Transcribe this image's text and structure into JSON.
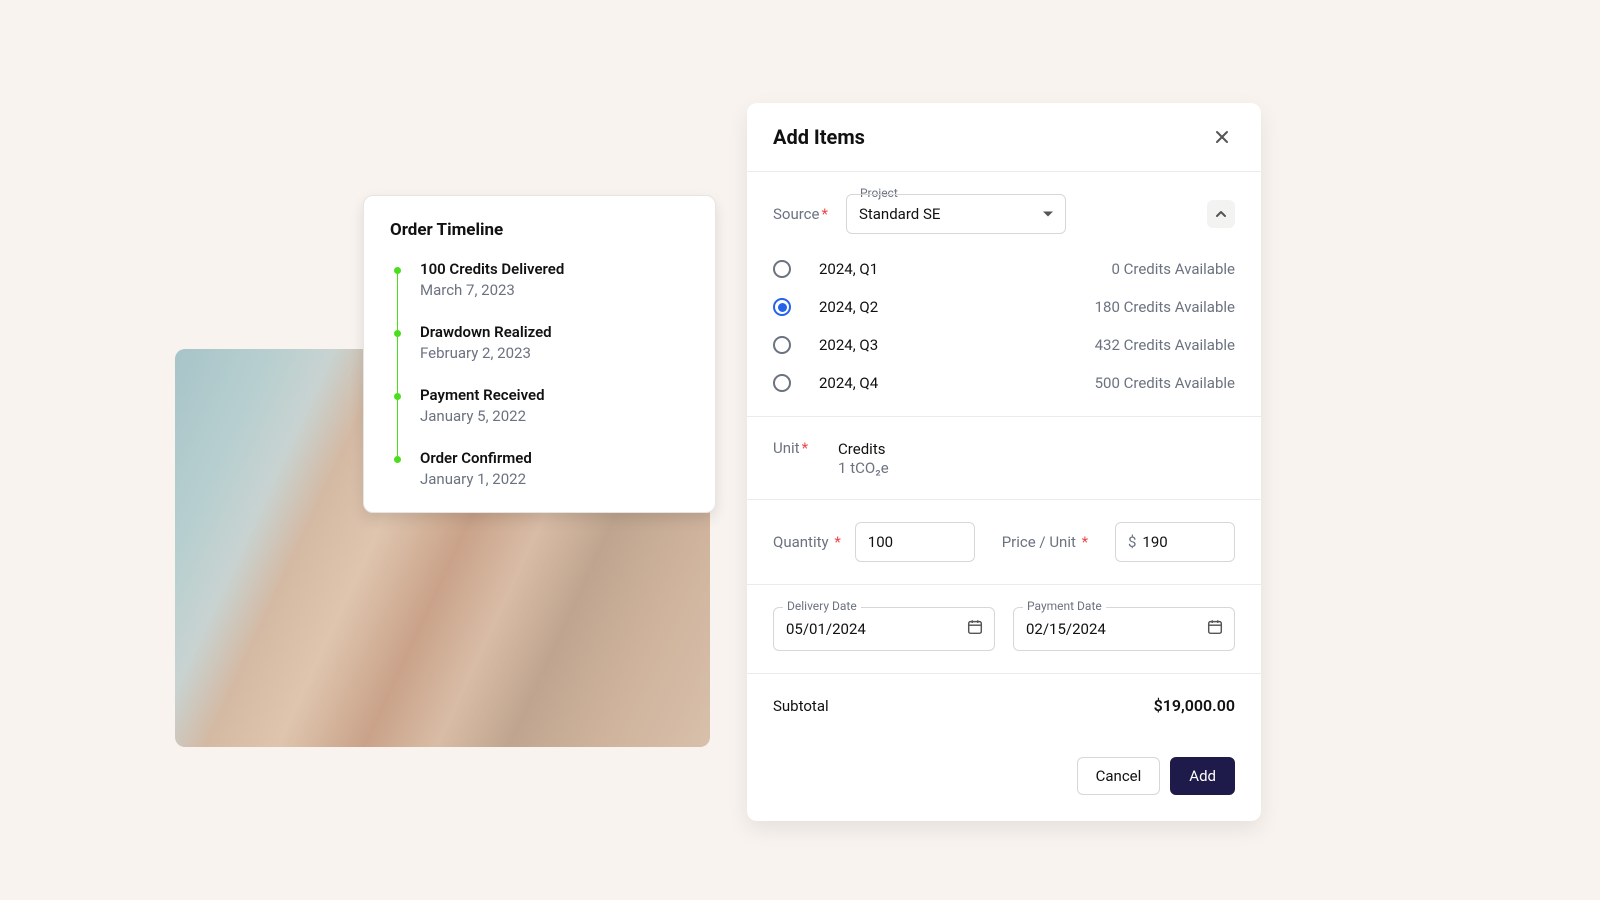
{
  "timeline": {
    "title": "Order Timeline",
    "events": [
      {
        "title": "100 Credits Delivered",
        "date": "March 7, 2023"
      },
      {
        "title": "Drawdown Realized",
        "date": "February 2, 2023"
      },
      {
        "title": "Payment Received",
        "date": "January 5, 2022"
      },
      {
        "title": "Order Confirmed",
        "date": "January 1, 2022"
      }
    ]
  },
  "modal": {
    "title": "Add Items",
    "source": {
      "label": "Source",
      "project_float_label": "Project",
      "project_value": "Standard SE"
    },
    "vintages": [
      {
        "label": "2024, Q1",
        "available": "0 Credits Available",
        "selected": false
      },
      {
        "label": "2024, Q2",
        "available": "180 Credits Available",
        "selected": true
      },
      {
        "label": "2024, Q3",
        "available": "432 Credits Available",
        "selected": false
      },
      {
        "label": "2024, Q4",
        "available": "500 Credits Available",
        "selected": false
      }
    ],
    "unit": {
      "label": "Unit",
      "value": "Credits",
      "sub": "1 tCO₂e"
    },
    "quantity": {
      "label": "Quantity",
      "value": "100"
    },
    "price": {
      "label": "Price / Unit",
      "prefix": "$",
      "value": "190"
    },
    "delivery_date": {
      "label": "Delivery Date",
      "value": "05/01/2024"
    },
    "payment_date": {
      "label": "Payment Date",
      "value": "02/15/2024"
    },
    "subtotal": {
      "label": "Subtotal",
      "value": "$19,000.00"
    },
    "buttons": {
      "cancel": "Cancel",
      "add": "Add"
    }
  }
}
